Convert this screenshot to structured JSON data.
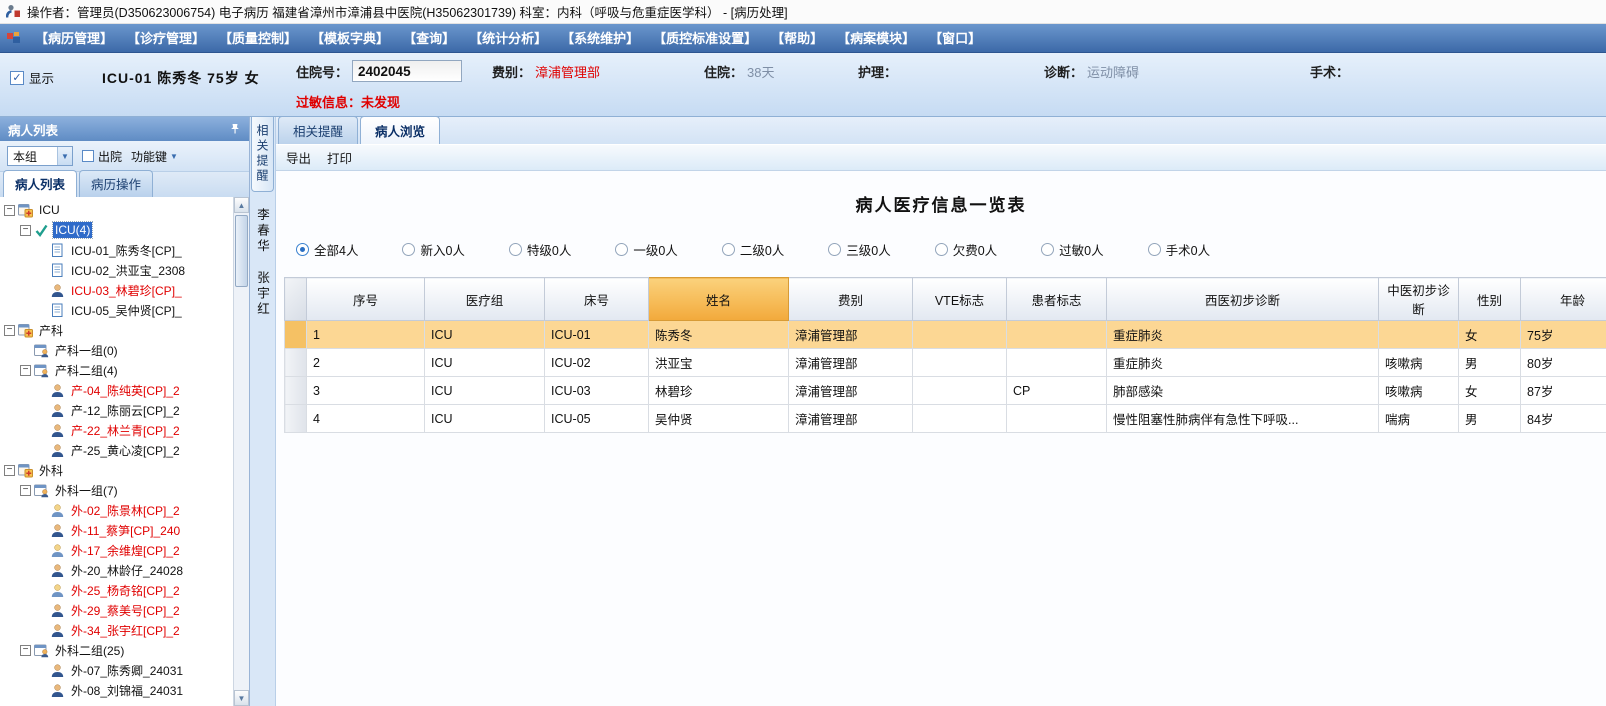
{
  "colors": {
    "menu_blue": "#3c69a8",
    "selection_row": "#fcd794",
    "header_highlight": "#f2a93b",
    "alert_red": "#e00000"
  },
  "title_bar": {
    "text": "操作者：管理员(D350623006754) 电子病历 福建省漳州市漳浦县中医院(H35062301739) 科室：内科（呼吸与危重症医学科） - [病历处理]"
  },
  "menu": {
    "items": [
      "【病历管理】",
      "【诊疗管理】",
      "【质量控制】",
      "【模板字典】",
      "【查询】",
      "【统计分析】",
      "【系统维护】",
      "【质控标准设置】",
      "【帮助】",
      "【病案模块】",
      "【窗口】"
    ]
  },
  "patient_bar": {
    "show_checkbox_label": "显示",
    "patient_summary": "ICU-01 陈秀冬 75岁 女",
    "fields": [
      {
        "label": "住院号：",
        "value": "2402045",
        "style": "input"
      },
      {
        "label": "费别：",
        "value": "漳浦管理部",
        "style": "red"
      },
      {
        "label": "住院：",
        "value": "38天",
        "style": "muted"
      },
      {
        "label": "护理：",
        "value": "",
        "style": "muted"
      },
      {
        "label": "诊断：",
        "value": "运动障碍",
        "style": "muted"
      },
      {
        "label": "手术：",
        "value": "",
        "style": "muted"
      }
    ],
    "allergy": {
      "label": "过敏信息：",
      "value": "未发现"
    }
  },
  "sidebar": {
    "title": "病人列表",
    "group_dropdown": "本组",
    "discharge_checkbox": "出院",
    "function_menu": "功能键",
    "tabs": [
      {
        "label": "病人列表",
        "active": true
      },
      {
        "label": "病历操作",
        "active": false
      }
    ],
    "tree": [
      {
        "level": 0,
        "expander": true,
        "icon": "dept",
        "label": "ICU"
      },
      {
        "level": 1,
        "expander": true,
        "icon": "check",
        "label": "ICU(4)",
        "selected": true
      },
      {
        "level": 2,
        "expander": false,
        "icon": "doc",
        "label": "ICU-01_陈秀冬[CP]_"
      },
      {
        "level": 2,
        "expander": false,
        "icon": "doc",
        "label": "ICU-02_洪亚宝_2308"
      },
      {
        "level": 2,
        "expander": false,
        "icon": "person",
        "label": "ICU-03_林碧珍[CP]_",
        "red": true
      },
      {
        "level": 2,
        "expander": false,
        "icon": "doc",
        "label": "ICU-05_吴仲贤[CP]_"
      },
      {
        "level": 0,
        "expander": true,
        "icon": "dept",
        "label": "产科"
      },
      {
        "level": 1,
        "expander": false,
        "icon": "group",
        "label": "产科一组(0)"
      },
      {
        "level": 1,
        "expander": true,
        "icon": "group",
        "label": "产科二组(4)"
      },
      {
        "level": 2,
        "expander": false,
        "icon": "person",
        "label": "产-04_陈纯英[CP]_2",
        "red": true
      },
      {
        "level": 2,
        "expander": false,
        "icon": "person",
        "label": "产-12_陈丽云[CP]_2"
      },
      {
        "level": 2,
        "expander": false,
        "icon": "person",
        "label": "产-22_林兰青[CP]_2",
        "red": true
      },
      {
        "level": 2,
        "expander": false,
        "icon": "person",
        "label": "产-25_黄心凌[CP]_2"
      },
      {
        "level": 0,
        "expander": true,
        "icon": "dept",
        "label": "外科"
      },
      {
        "level": 1,
        "expander": true,
        "icon": "group",
        "label": "外科一组(7)"
      },
      {
        "level": 2,
        "expander": false,
        "icon": "person2",
        "label": "外-02_陈景林[CP]_2",
        "red": true
      },
      {
        "level": 2,
        "expander": false,
        "icon": "person",
        "label": "外-11_蔡笋[CP]_240",
        "red": true
      },
      {
        "level": 2,
        "expander": false,
        "icon": "person2",
        "label": "外-17_余维煌[CP]_2",
        "red": true
      },
      {
        "level": 2,
        "expander": false,
        "icon": "person",
        "label": "外-20_林龄仔_24028"
      },
      {
        "level": 2,
        "expander": false,
        "icon": "person2",
        "label": "外-25_杨奇铭[CP]_2",
        "red": true
      },
      {
        "level": 2,
        "expander": false,
        "icon": "person",
        "label": "外-29_蔡美号[CP]_2",
        "red": true
      },
      {
        "level": 2,
        "expander": false,
        "icon": "person",
        "label": "外-34_张宇红[CP]_2",
        "red": true
      },
      {
        "level": 1,
        "expander": true,
        "icon": "group",
        "label": "外科二组(25)"
      },
      {
        "level": 2,
        "expander": false,
        "icon": "person",
        "label": "外-07_陈秀卿_24031"
      },
      {
        "level": 2,
        "expander": false,
        "icon": "person",
        "label": "外-08_刘锦福_24031"
      }
    ]
  },
  "strip": {
    "collapsed_tab": "相关提醒",
    "names": [
      "李春华",
      "张宇红"
    ]
  },
  "main": {
    "tabs": [
      {
        "label": "相关提醒",
        "active": false
      },
      {
        "label": "病人浏览",
        "active": true
      }
    ],
    "toolbar": [
      "导出",
      "打印"
    ],
    "overview": {
      "title": "病人医疗信息一览表",
      "filters": [
        {
          "label": "全部4人",
          "selected": true
        },
        {
          "label": "新入0人",
          "selected": false
        },
        {
          "label": "特级0人",
          "selected": false
        },
        {
          "label": "一级0人",
          "selected": false
        },
        {
          "label": "二级0人",
          "selected": false
        },
        {
          "label": "三级0人",
          "selected": false
        },
        {
          "label": "欠费0人",
          "selected": false
        },
        {
          "label": "过敏0人",
          "selected": false
        },
        {
          "label": "手术0人",
          "selected": false
        }
      ],
      "table": {
        "columns": [
          "序号",
          "医疗组",
          "床号",
          "姓名",
          "费别",
          "VTE标志",
          "患者标志",
          "西医初步诊断",
          "中医初步诊断",
          "性别",
          "年龄"
        ],
        "highlight_column": "姓名",
        "selected_row_index": 0,
        "rows": [
          [
            "1",
            "ICU",
            "ICU-01",
            "陈秀冬",
            "漳浦管理部",
            "",
            "",
            "重症肺炎",
            "",
            "女",
            "75岁"
          ],
          [
            "2",
            "ICU",
            "ICU-02",
            "洪亚宝",
            "漳浦管理部",
            "",
            "",
            "重症肺炎",
            "咳嗽病",
            "男",
            "80岁"
          ],
          [
            "3",
            "ICU",
            "ICU-03",
            "林碧珍",
            "漳浦管理部",
            "",
            "CP",
            "肺部感染",
            "咳嗽病",
            "女",
            "87岁"
          ],
          [
            "4",
            "ICU",
            "ICU-05",
            "吴仲贤",
            "漳浦管理部",
            "",
            "",
            "慢性阻塞性肺病伴有急性下呼吸...",
            "喘病",
            "男",
            "84岁"
          ]
        ]
      }
    }
  }
}
